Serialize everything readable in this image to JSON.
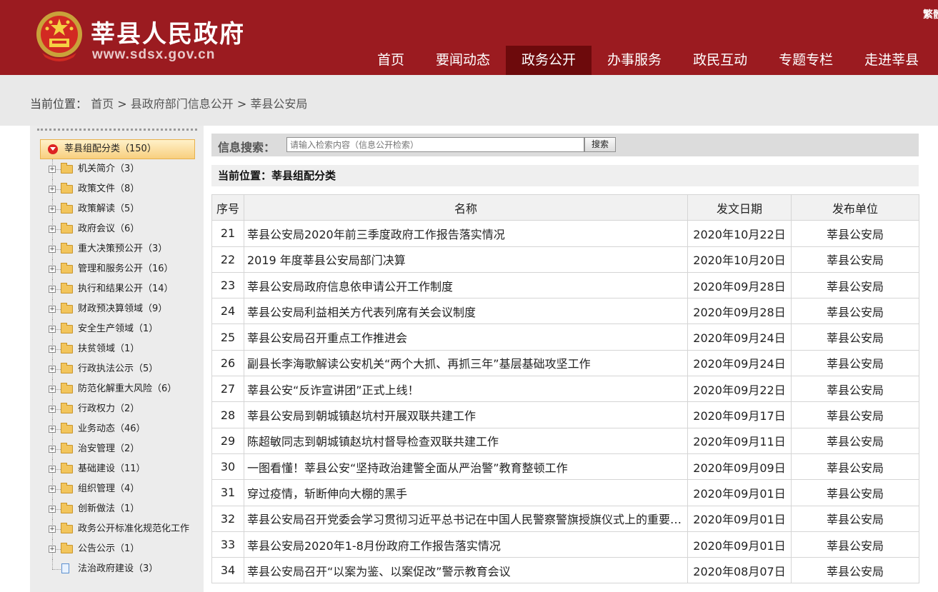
{
  "header": {
    "title": "莘县人民政府",
    "url": "www.sdsx.gov.cn",
    "trad_link": "繁體"
  },
  "nav": [
    "首页",
    "要闻动态",
    "政务公开",
    "办事服务",
    "政民互动",
    "专题专栏",
    "走进莘县"
  ],
  "nav_active": "政务公开",
  "breadcrumb": {
    "prefix": "当前位置：",
    "items": [
      "首页",
      ">",
      "县政府部门信息公开",
      ">",
      "莘县公安局"
    ]
  },
  "sidebar": {
    "root": "莘县组配分类（150）",
    "items": [
      "机关简介（3）",
      "政策文件（8）",
      "政策解读（5）",
      "政府会议（6）",
      "重大决策预公开（3）",
      "管理和服务公开（16）",
      "执行和结果公开（14）",
      "财政预决算领域（9）",
      "安全生产领域（1）",
      "扶贫领域（1）",
      "行政执法公示（5）",
      "防范化解重大风险（6）",
      "行政权力（2）",
      "业务动态（46）",
      "治安管理（2）",
      "基础建设（11）",
      "组织管理（4）",
      "创新做法（1）",
      "政务公开标准化规范化工作",
      "公告公示（1）",
      "法治政府建设（3）"
    ]
  },
  "search": {
    "label": "信息搜索：",
    "placeholder": "请输入检索内容（信息公开检索）",
    "button": "搜索"
  },
  "current_position": "当前位置：莘县组配分类",
  "table": {
    "headers": [
      "序号",
      "名称",
      "发文日期",
      "发布单位"
    ],
    "rows": [
      [
        "21",
        "莘县公安局2020年前三季度政府工作报告落实情况",
        "2020年10月22日",
        "莘县公安局"
      ],
      [
        "22",
        "2019 年度莘县公安局部门决算",
        "2020年10月20日",
        "莘县公安局"
      ],
      [
        "23",
        "莘县公安局政府信息依申请公开工作制度",
        "2020年09月28日",
        "莘县公安局"
      ],
      [
        "24",
        "莘县公安局利益相关方代表列席有关会议制度",
        "2020年09月28日",
        "莘县公安局"
      ],
      [
        "25",
        "莘县公安局召开重点工作推进会",
        "2020年09月24日",
        "莘县公安局"
      ],
      [
        "26",
        "副县长李海歌解读公安机关“两个大抓、再抓三年”基层基础攻坚工作",
        "2020年09月24日",
        "莘县公安局"
      ],
      [
        "27",
        "莘县公安“反诈宣讲团”正式上线！",
        "2020年09月22日",
        "莘县公安局"
      ],
      [
        "28",
        "莘县公安局到朝城镇赵坑村开展双联共建工作",
        "2020年09月17日",
        "莘县公安局"
      ],
      [
        "29",
        "陈超敏同志到朝城镇赵坑村督导检查双联共建工作",
        "2020年09月11日",
        "莘县公安局"
      ],
      [
        "30",
        "一图看懂！莘县公安“坚持政治建警全面从严治警”教育整顿工作",
        "2020年09月09日",
        "莘县公安局"
      ],
      [
        "31",
        "穿过疫情，斩断伸向大棚的黑手",
        "2020年09月01日",
        "莘县公安局"
      ],
      [
        "32",
        "莘县公安局召开党委会学习贯彻习近平总书记在中国人民警察警旗授旗仪式上的重要训词精神",
        "2020年09月01日",
        "莘县公安局"
      ],
      [
        "33",
        "莘县公安局2020年1-8月份政府工作报告落实情况",
        "2020年09月01日",
        "莘县公安局"
      ],
      [
        "34",
        "莘县公安局召开“以案为鉴、以案促改”警示教育会议",
        "2020年08月07日",
        "莘县公安局"
      ]
    ]
  }
}
